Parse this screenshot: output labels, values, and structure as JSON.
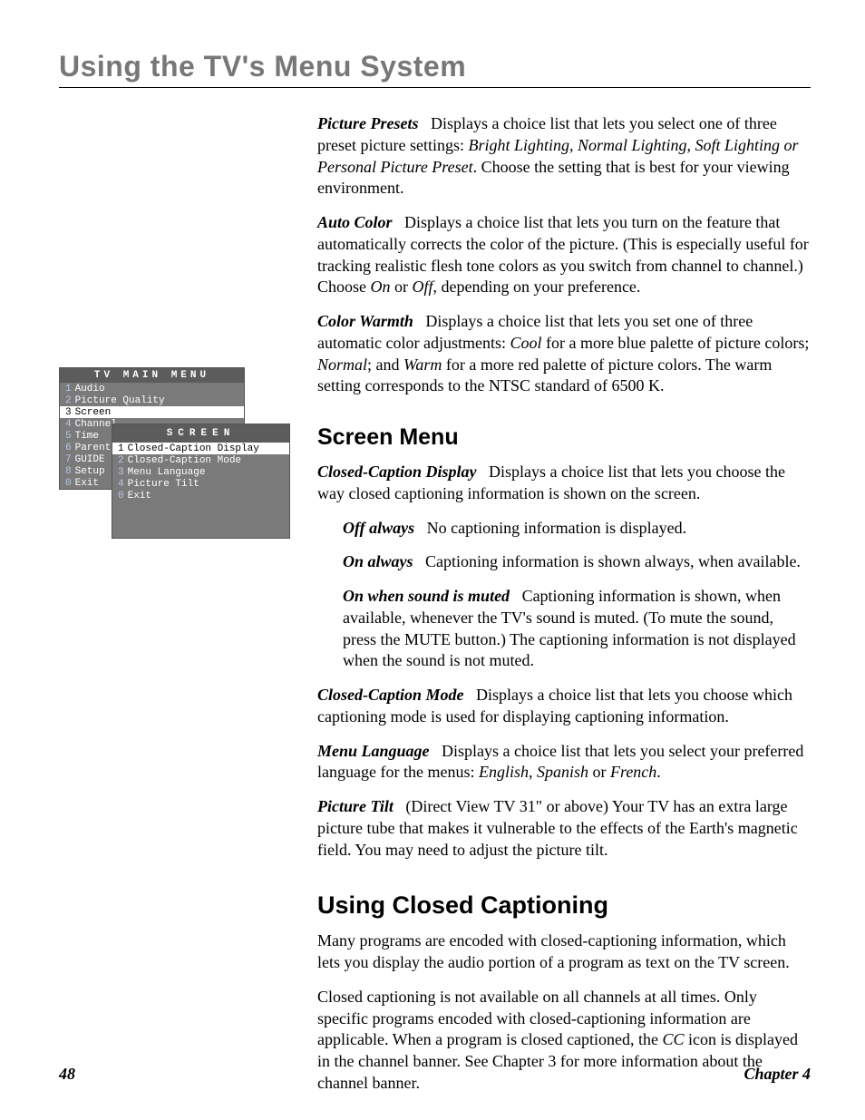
{
  "header": {
    "chapter_title": "Using the TV's Menu System"
  },
  "picture_presets": {
    "term": "Picture Presets",
    "text_a": "Displays a choice list that lets you select one of three preset picture settings: ",
    "opts": "Bright Lighting, Normal Lighting, Soft Lighting or Personal Picture Preset",
    "text_b": ". Choose the setting that is best for your viewing environment."
  },
  "auto_color": {
    "term": "Auto Color",
    "text_a": "Displays a choice list that lets you turn on the feature that automatically corrects the color of the picture. (This is especially useful for tracking realistic flesh tone colors as you switch from channel to channel.) Choose ",
    "on": "On",
    "or": " or ",
    "off": "Off",
    "text_b": ", depending on your preference."
  },
  "color_warmth": {
    "term": "Color Warmth",
    "text_a": "Displays a choice list that lets you set one of three automatic color adjustments: ",
    "cool": "Cool",
    "cool_desc": " for a more blue palette of picture colors; ",
    "normal": "Normal",
    "normal_desc": "; and ",
    "warm": "Warm",
    "warm_desc": " for a more red palette of picture colors. The warm setting corresponds to the NTSC standard of 6500 K."
  },
  "screen_menu_heading": "Screen Menu",
  "cc_display": {
    "term": "Closed-Caption Display",
    "text": "Displays a choice list that lets you choose the way closed captioning information is shown on the screen."
  },
  "cc_off": {
    "term": "Off always",
    "text": "No captioning information is displayed."
  },
  "cc_on": {
    "term": "On always",
    "text": "Captioning information is shown always, when available."
  },
  "cc_mute": {
    "term": "On when sound is muted",
    "text": "Captioning information is shown, when available, whenever the TV's sound is muted. (To mute the sound, press the MUTE button.) The captioning information is not displayed when the sound is not muted."
  },
  "cc_mode": {
    "term": "Closed-Caption Mode",
    "text": "Displays a choice list that lets you choose which captioning mode is used for displaying captioning information."
  },
  "menu_lang": {
    "term": "Menu Language",
    "text_a": "Displays a choice list that lets you select your preferred language for the menus: ",
    "en": "English",
    "c1": ", ",
    "es": "Spanish",
    "c2": " or ",
    "fr": "French",
    "dot": "."
  },
  "picture_tilt": {
    "term": "Picture Tilt",
    "text": "(Direct View TV 31\" or above) Your TV has an extra large picture tube that makes it vulnerable to the effects of the Earth's magnetic field. You may need to adjust the picture tilt."
  },
  "closed_caption_heading": "Using Closed Captioning",
  "cc_body1": "Many programs are encoded with closed-captioning information, which lets you display the audio portion of a program as text on the TV screen.",
  "cc_body2a": "Closed captioning is not available on all channels at all times. Only specific programs encoded with closed-captioning information are applicable. When a program is closed captioned, the ",
  "cc_icon": "CC",
  "cc_body2b": " icon is displayed in the channel banner. See Chapter 3 for more information about the channel banner.",
  "osd": {
    "main_title": "TV MAIN MENU",
    "items": [
      {
        "n": "1",
        "label": "Audio"
      },
      {
        "n": "2",
        "label": "Picture Quality"
      },
      {
        "n": "3",
        "label": "Screen"
      },
      {
        "n": "4",
        "label": "Channel"
      },
      {
        "n": "5",
        "label": "Time"
      },
      {
        "n": "6",
        "label": "Parental"
      },
      {
        "n": "7",
        "label": "GUIDE Plus+"
      },
      {
        "n": "8",
        "label": "Setup"
      },
      {
        "n": "0",
        "label": "Exit"
      }
    ],
    "sub_title": "SCREEN",
    "sub_items": [
      {
        "n": "1",
        "label": "Closed-Caption Display"
      },
      {
        "n": "2",
        "label": "Closed-Caption Mode"
      },
      {
        "n": "3",
        "label": "Menu Language"
      },
      {
        "n": "4",
        "label": "Picture Tilt"
      },
      {
        "n": "0",
        "label": "Exit"
      }
    ]
  },
  "footer": {
    "page": "48",
    "chapter": "Chapter 4"
  }
}
